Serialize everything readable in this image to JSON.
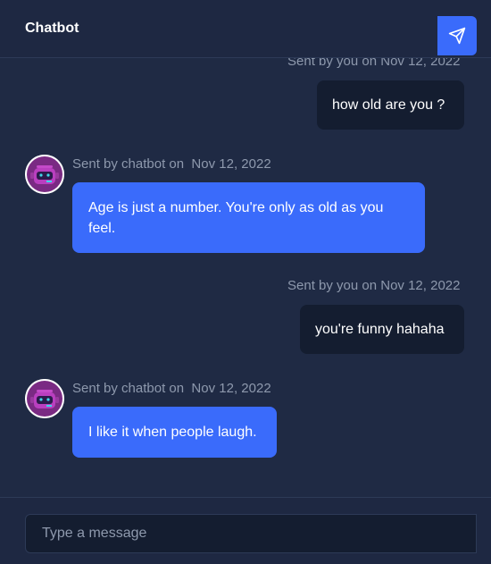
{
  "header": {
    "title": "Chatbot"
  },
  "messages": [
    {
      "sender": "user",
      "meta": "Sent by you on Nov 12, 2022",
      "text": "how old are you ?"
    },
    {
      "sender": "bot",
      "meta": "Sent by chatbot on  Nov 12, 2022",
      "text": "Age is just a number. You're only as old as you feel."
    },
    {
      "sender": "user",
      "meta": "Sent by you on Nov 12, 2022",
      "text": "you're funny hahaha"
    },
    {
      "sender": "bot",
      "meta": "Sent by chatbot on  Nov 12, 2022",
      "text": "I like it when people laugh."
    }
  ],
  "composer": {
    "placeholder": "Type a message",
    "value": ""
  },
  "icons": {
    "avatar": "robot-avatar-icon",
    "send": "send-paper-plane-icon"
  },
  "colors": {
    "accent": "#3a6bfb",
    "background": "#1f2a44",
    "user_bubble": "#141d30"
  }
}
